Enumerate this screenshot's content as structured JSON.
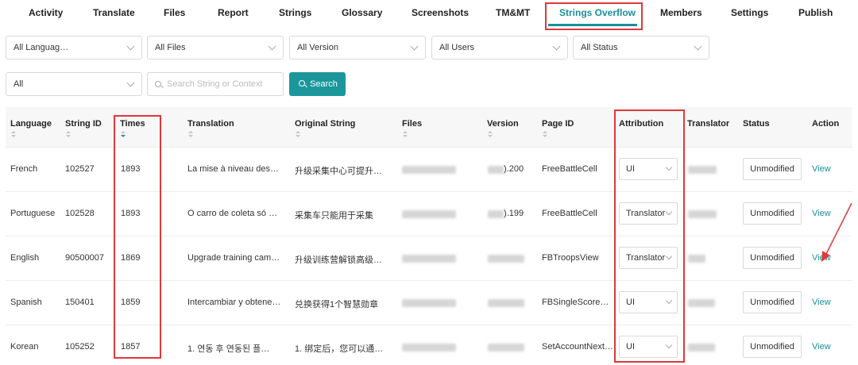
{
  "nav": {
    "tabs": [
      {
        "label": "Activity"
      },
      {
        "label": "Translate"
      },
      {
        "label": "Files"
      },
      {
        "label": "Report"
      },
      {
        "label": "Strings"
      },
      {
        "label": "Glossary"
      },
      {
        "label": "Screenshots"
      },
      {
        "label": "TM&MT"
      },
      {
        "label": "Strings Overflow",
        "active": true
      },
      {
        "label": "Members"
      },
      {
        "label": "Settings"
      },
      {
        "label": "Publish"
      }
    ]
  },
  "filters": {
    "language": "All Languag…",
    "files": "All Files",
    "version": "All Version",
    "users": "All Users",
    "status": "All Status",
    "scope": "All",
    "search_placeholder": "Search String or Context",
    "search_button": "Search"
  },
  "table": {
    "columns": [
      "Language",
      "String ID",
      "Times",
      "Translation",
      "Original String",
      "Files",
      "Version",
      "Page ID",
      "Attribution",
      "Translator",
      "Status",
      "Action"
    ],
    "rows": [
      {
        "language": "French",
        "string_id": "102527",
        "times": "1893",
        "translation": "La mise à niveau des…",
        "original": "升级采集中心可提升…",
        "version": ").200",
        "page_id": "FreeBattleCell",
        "attribution": "UI",
        "status": "Unmodified",
        "action": "View"
      },
      {
        "language": "Portuguese",
        "string_id": "102528",
        "times": "1893",
        "translation": "O carro de coleta só …",
        "original": "采集车只能用于采集",
        "version": ").199",
        "page_id": "FreeBattleCell",
        "attribution": "Translator",
        "status": "Unmodified",
        "action": "View"
      },
      {
        "language": "English",
        "string_id": "90500007",
        "times": "1869",
        "translation": "Upgrade training cam…",
        "original": "升级训练营解锁高级…",
        "version": "",
        "page_id": "FBTroopsView",
        "attribution": "Translator",
        "status": "Unmodified",
        "action": "View"
      },
      {
        "language": "Spanish",
        "string_id": "150401",
        "times": "1859",
        "translation": "Intercambiar y obtene…",
        "original": "兑换获得1个智慧勋章",
        "version": "",
        "page_id": "FBSingleScoreCell",
        "attribution": "UI",
        "status": "Unmodified",
        "action": "View"
      },
      {
        "language": "Korean",
        "string_id": "105252",
        "times": "1857",
        "translation": "1. 연동 후 연동된 플…",
        "original": "1. 绑定后，您可以通…",
        "version": "",
        "page_id": "SetAccountNext…",
        "attribution": "UI",
        "status": "Unmodified",
        "action": "View"
      }
    ]
  }
}
